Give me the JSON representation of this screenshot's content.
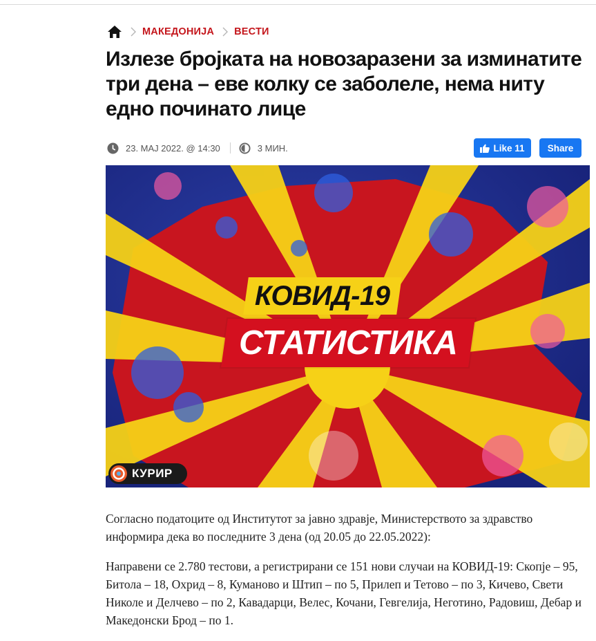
{
  "breadcrumb": {
    "home_icon": "home-icon",
    "items": [
      "МАКЕДОНИЈА",
      "ВЕСТИ"
    ]
  },
  "article": {
    "title": "Излезе бројката на новозаразени за изминатите три дена – еве колку се заболеле, нема ниту едно починато лице",
    "date": "23. МАЈ 2022. @ 14:30",
    "read_time": "3 МИН.",
    "paragraphs": [
      "Согласно податоците од Институтот за јавно здравје, Министерството за здравство информира дека во последните 3 дена (од 20.05 до 22.05.2022):",
      "Направени се 2.780 тестови, а регистрирани се 151 нови случаи на КОВИД-19: Скопје – 95, Битола – 18, Охрид – 8, Куманово и Штип – по 5, Прилеп и Тетово – по 3, Кичево, Свети Николе и Делчево – по 2, Кавадарци, Велес, Кочани, Гевгелија, Неготино, Радовиш, Дебар и Македонски Брод – по 1."
    ]
  },
  "social": {
    "like_label": "Like 11",
    "share_label": "Share"
  },
  "hero": {
    "line1": "КОВИД-19",
    "line2": "СТАТИСТИКА",
    "brand": "КУРИР"
  },
  "colors": {
    "accent": "#c4161c",
    "facebook": "#1877f2",
    "hero_red": "#d4101f",
    "hero_yellow": "#f6d117",
    "hero_blue": "#1f2f8c"
  }
}
